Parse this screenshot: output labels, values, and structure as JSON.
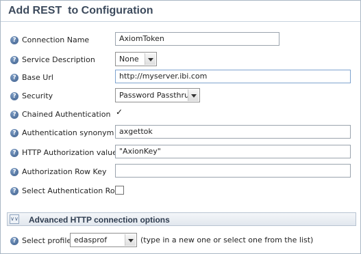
{
  "header": {
    "title": "Add REST  to Configuration"
  },
  "fields": {
    "connection_name": {
      "label": "Connection Name",
      "value": "AxiomToken"
    },
    "service_description": {
      "label": "Service Description",
      "selected": "None"
    },
    "base_url": {
      "label": "Base Url",
      "value": "http://myserver.ibi.com"
    },
    "security": {
      "label": "Security",
      "selected": "Password Passthru"
    },
    "chained_authentication": {
      "label": "Chained Authentication",
      "checked": "✓"
    },
    "authentication_synonym": {
      "label": "Authentication synonym",
      "value": "axgettok"
    },
    "http_authorization_value": {
      "label": "HTTP Authorization value",
      "value": "\"AxionKey\""
    },
    "authorization_row_key": {
      "label": "Authorization Row Key",
      "value": ""
    },
    "select_authentication_row": {
      "label": "Select Authentication Row"
    }
  },
  "advanced": {
    "title": "Advanced HTTP connection options",
    "toggle_icon": "double-chevron-down"
  },
  "profile": {
    "label": "Select profile",
    "selected": "edasprof",
    "hint": "(type in a new one or select one from the list)"
  },
  "help_icon_glyph": "?",
  "colors": {
    "title": "#3c4a5c",
    "panel_border": "#a9b6c4",
    "help_icon": "#3e5f8c"
  }
}
